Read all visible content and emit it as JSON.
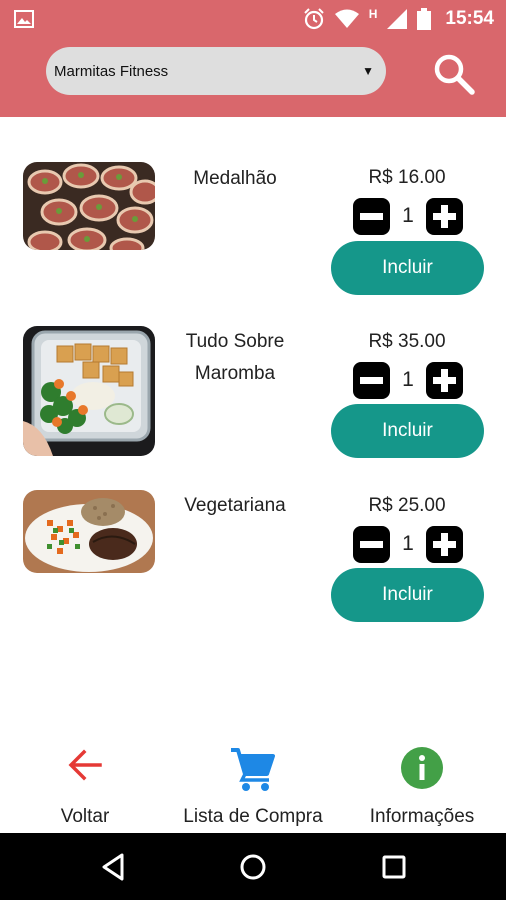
{
  "status_bar": {
    "time": "15:54",
    "network_indicator": "H",
    "icons": [
      "image-notification-icon",
      "alarm-icon",
      "wifi-icon",
      "signal-icon",
      "battery-icon"
    ]
  },
  "header": {
    "category_value": "Marmitas Fitness",
    "search_icon": "search-icon",
    "color": "#d9676c"
  },
  "products": [
    {
      "name": "Medalhão",
      "price": "R$ 16.00",
      "quantity": "1",
      "button_label": "Incluir"
    },
    {
      "name": "Tudo Sobre Maromba",
      "price": "R$ 35.00",
      "quantity": "1",
      "button_label": "Incluir"
    },
    {
      "name": "Vegetariana",
      "price": "R$ 25.00",
      "quantity": "1",
      "button_label": "Incluir"
    }
  ],
  "bottom_nav": [
    {
      "label": "Voltar",
      "icon": "arrow-left-icon",
      "color": "#e53935"
    },
    {
      "label": "Lista de Compra",
      "icon": "cart-icon",
      "color": "#1e88e5"
    },
    {
      "label": "Informações",
      "icon": "info-icon",
      "color": "#43a047"
    }
  ],
  "colors": {
    "accent": "#15978a"
  }
}
